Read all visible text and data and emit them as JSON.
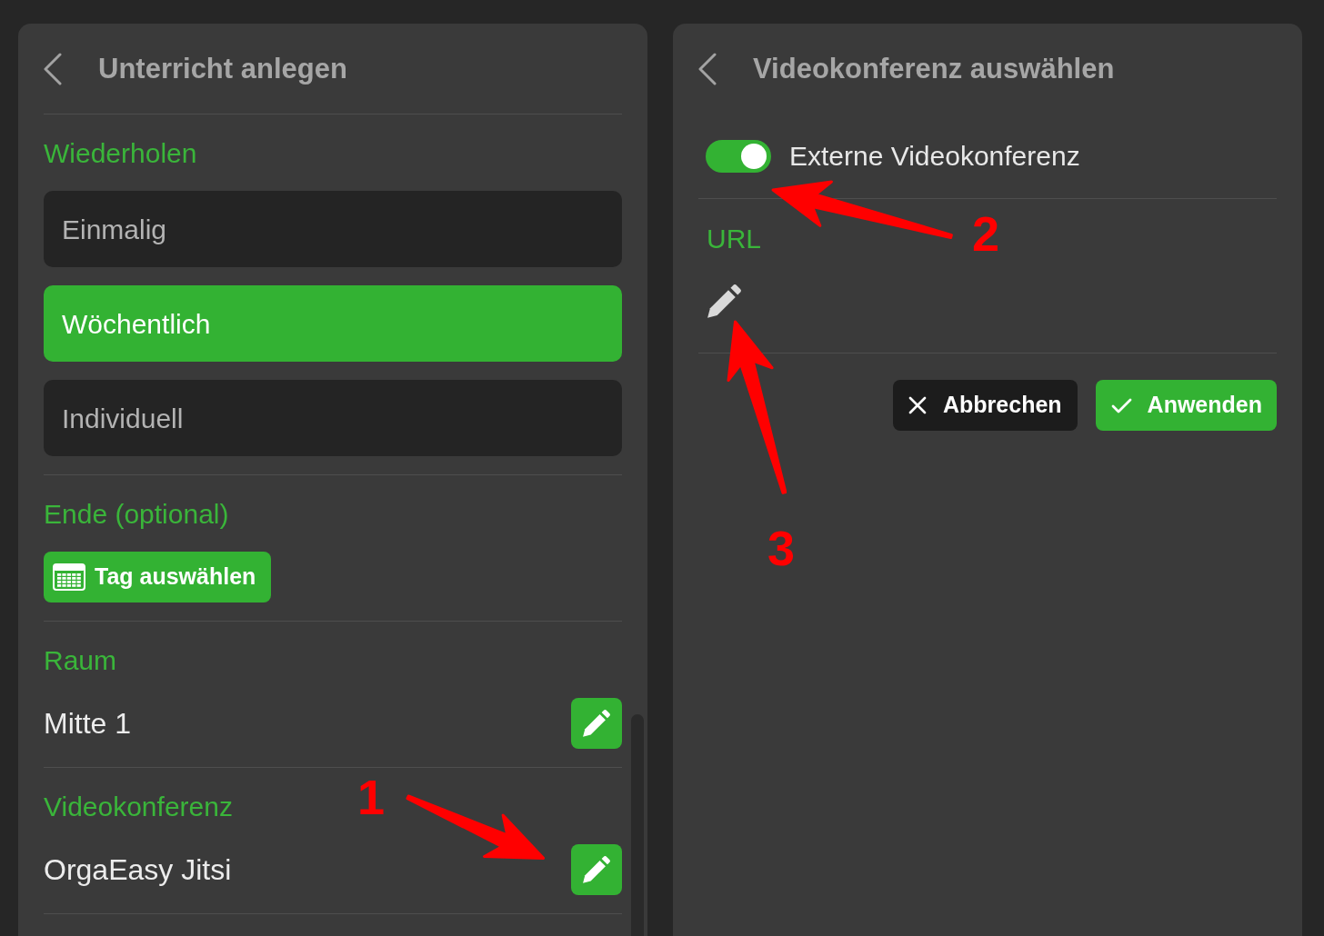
{
  "left_panel": {
    "title": "Unterricht anlegen",
    "sections": [
      {
        "kind": "options",
        "label": "Wiederholen",
        "options": [
          {
            "label": "Einmalig",
            "selected": false
          },
          {
            "label": "Wöchentlich",
            "selected": true
          },
          {
            "label": "Individuell",
            "selected": false
          }
        ]
      },
      {
        "kind": "button",
        "label": "Ende (optional)",
        "button": "Tag auswählen"
      },
      {
        "kind": "value",
        "label": "Raum",
        "value": "Mitte 1"
      },
      {
        "kind": "value",
        "label": "Videokonferenz",
        "value": "OrgaEasy Jitsi"
      }
    ]
  },
  "right_panel": {
    "title": "Videokonferenz auswählen",
    "toggle": {
      "label": "Externe Videokonferenz",
      "on": true
    },
    "url": {
      "label": "URL"
    },
    "buttons": [
      {
        "kind": "cancel",
        "label": "Abbrechen"
      },
      {
        "kind": "apply",
        "label": "Anwenden"
      }
    ]
  },
  "annotations": [
    {
      "label": "1"
    },
    {
      "label": "2"
    },
    {
      "label": "3"
    }
  ]
}
